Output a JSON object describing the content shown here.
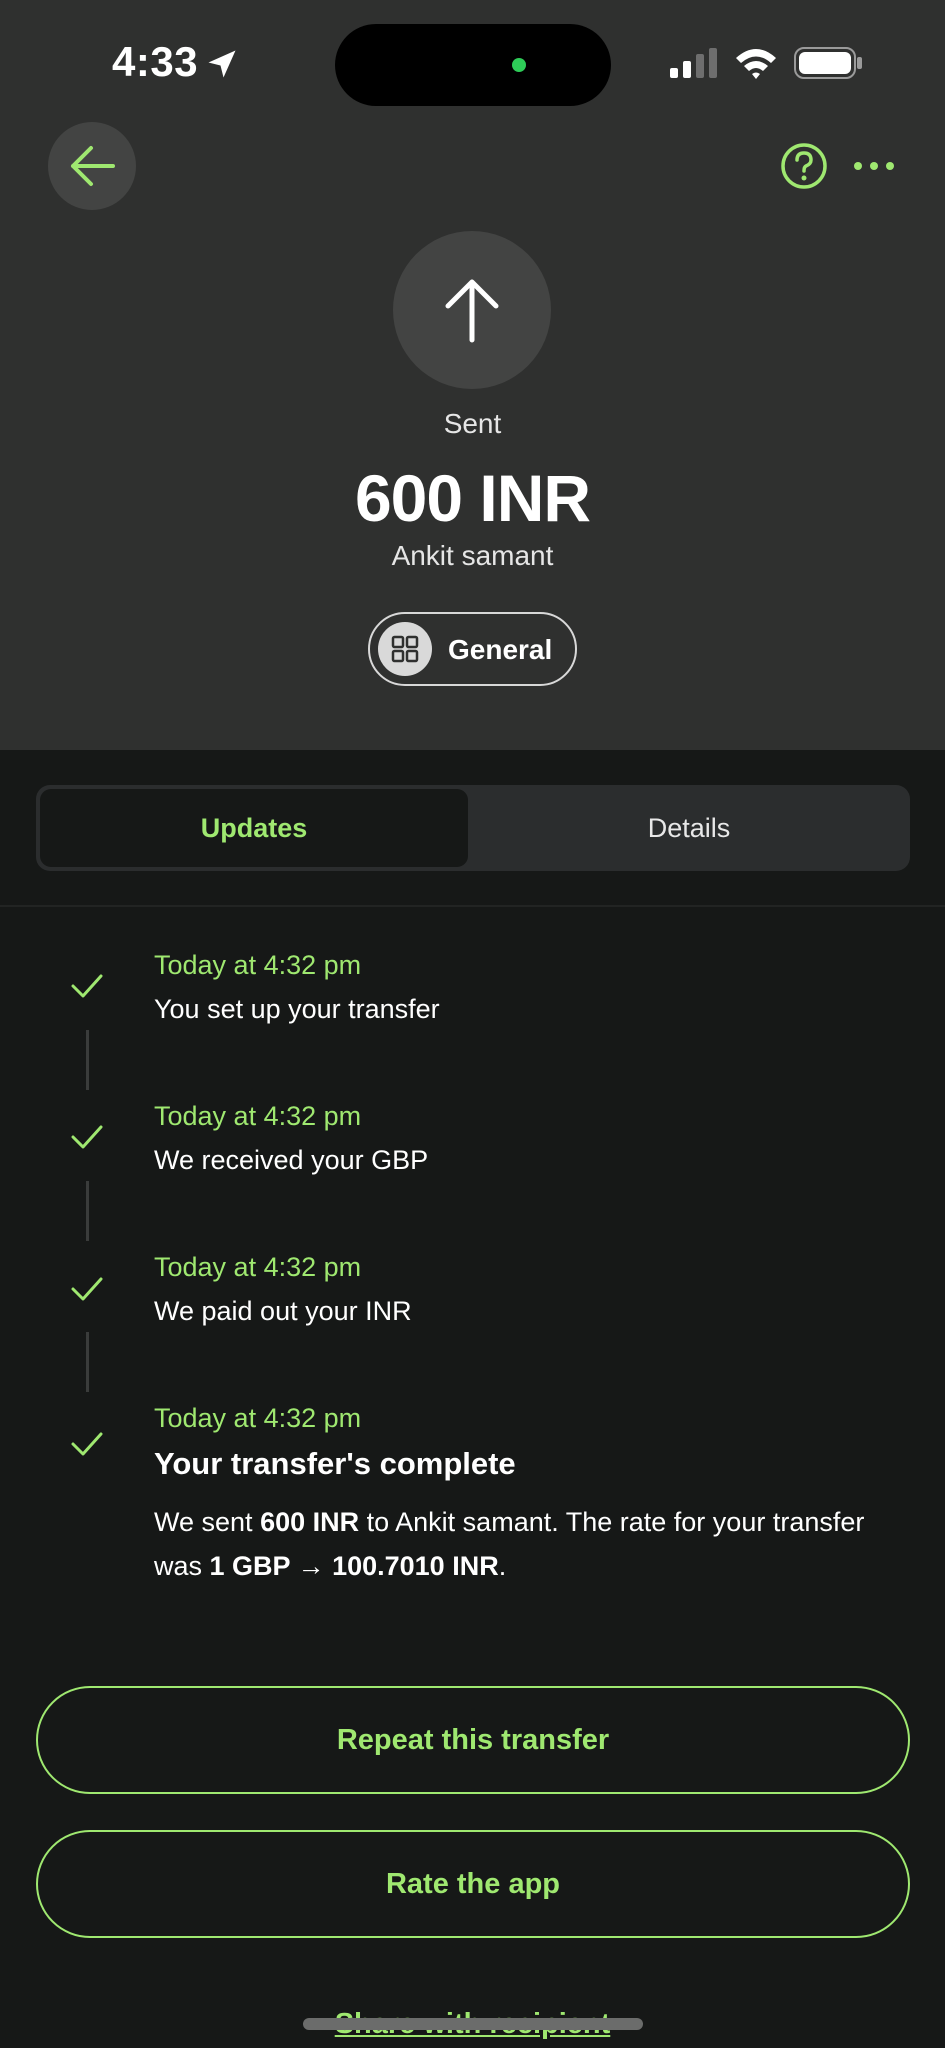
{
  "status_bar": {
    "time": "4:33"
  },
  "header": {
    "status_label": "Sent",
    "amount": "600 INR",
    "recipient": "Ankit samant",
    "category": "General"
  },
  "tabs": [
    {
      "label": "Updates",
      "active": true
    },
    {
      "label": "Details",
      "active": false
    }
  ],
  "timeline": [
    {
      "time": "Today at 4:32 pm",
      "text": "You set up your transfer"
    },
    {
      "time": "Today at 4:32 pm",
      "text": "We received your GBP"
    },
    {
      "time": "Today at 4:32 pm",
      "text": "We paid out your INR"
    },
    {
      "time": "Today at 4:32 pm",
      "text": "Your transfer's complete"
    }
  ],
  "complete": {
    "p1": "We sent ",
    "amount": "600 INR",
    "p2": " to Ankit samant. The rate for your transfer was ",
    "rate": "1 GBP → 100.7010 INR",
    "p3": "."
  },
  "actions": {
    "repeat": "Repeat this transfer",
    "rate": "Rate the app",
    "share": "Share with recipient"
  },
  "colors": {
    "accent": "#9fe870",
    "header_bg": "#2f302f",
    "body_bg": "#161817"
  },
  "icons": {
    "back": "arrow-left-icon",
    "help": "help-icon",
    "more": "more-icon",
    "direction": "arrow-up-icon",
    "category": "grid-icon",
    "check": "check-icon"
  }
}
